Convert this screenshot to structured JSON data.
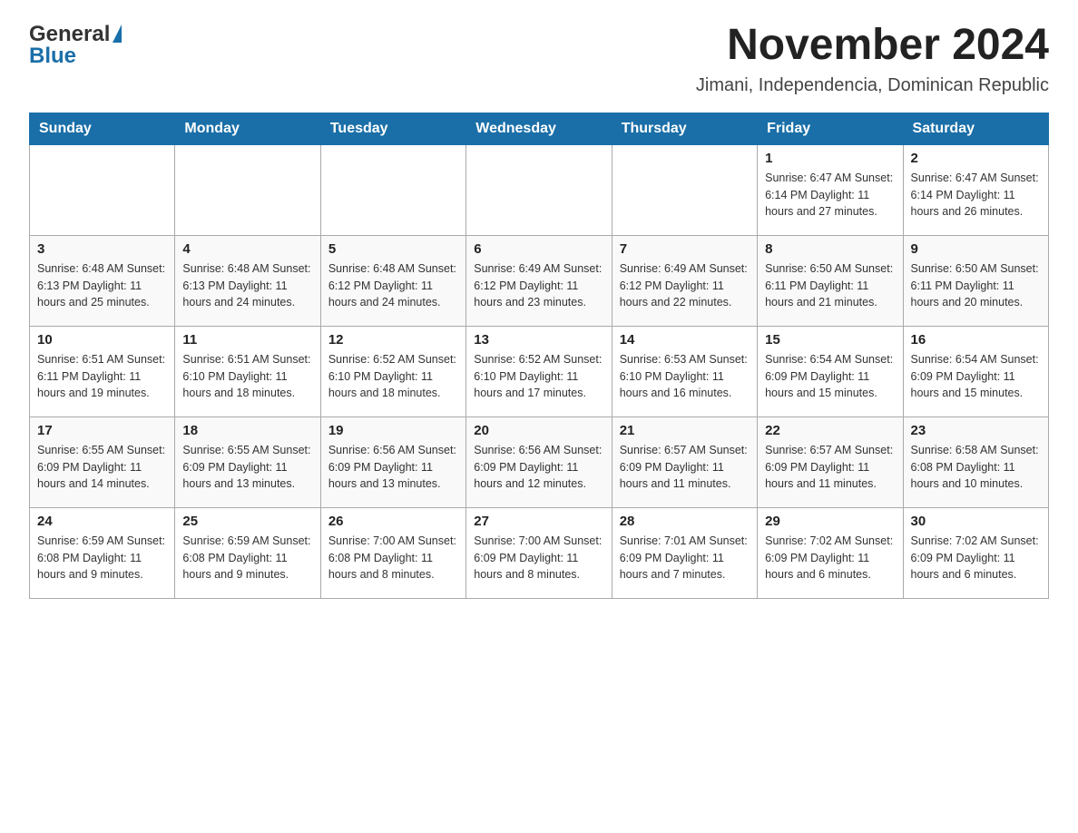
{
  "logo": {
    "general": "General",
    "blue": "Blue"
  },
  "title": "November 2024",
  "location": "Jimani, Independencia, Dominican Republic",
  "days_of_week": [
    "Sunday",
    "Monday",
    "Tuesday",
    "Wednesday",
    "Thursday",
    "Friday",
    "Saturday"
  ],
  "weeks": [
    [
      {
        "day": "",
        "info": ""
      },
      {
        "day": "",
        "info": ""
      },
      {
        "day": "",
        "info": ""
      },
      {
        "day": "",
        "info": ""
      },
      {
        "day": "",
        "info": ""
      },
      {
        "day": "1",
        "info": "Sunrise: 6:47 AM\nSunset: 6:14 PM\nDaylight: 11 hours\nand 27 minutes."
      },
      {
        "day": "2",
        "info": "Sunrise: 6:47 AM\nSunset: 6:14 PM\nDaylight: 11 hours\nand 26 minutes."
      }
    ],
    [
      {
        "day": "3",
        "info": "Sunrise: 6:48 AM\nSunset: 6:13 PM\nDaylight: 11 hours\nand 25 minutes."
      },
      {
        "day": "4",
        "info": "Sunrise: 6:48 AM\nSunset: 6:13 PM\nDaylight: 11 hours\nand 24 minutes."
      },
      {
        "day": "5",
        "info": "Sunrise: 6:48 AM\nSunset: 6:12 PM\nDaylight: 11 hours\nand 24 minutes."
      },
      {
        "day": "6",
        "info": "Sunrise: 6:49 AM\nSunset: 6:12 PM\nDaylight: 11 hours\nand 23 minutes."
      },
      {
        "day": "7",
        "info": "Sunrise: 6:49 AM\nSunset: 6:12 PM\nDaylight: 11 hours\nand 22 minutes."
      },
      {
        "day": "8",
        "info": "Sunrise: 6:50 AM\nSunset: 6:11 PM\nDaylight: 11 hours\nand 21 minutes."
      },
      {
        "day": "9",
        "info": "Sunrise: 6:50 AM\nSunset: 6:11 PM\nDaylight: 11 hours\nand 20 minutes."
      }
    ],
    [
      {
        "day": "10",
        "info": "Sunrise: 6:51 AM\nSunset: 6:11 PM\nDaylight: 11 hours\nand 19 minutes."
      },
      {
        "day": "11",
        "info": "Sunrise: 6:51 AM\nSunset: 6:10 PM\nDaylight: 11 hours\nand 18 minutes."
      },
      {
        "day": "12",
        "info": "Sunrise: 6:52 AM\nSunset: 6:10 PM\nDaylight: 11 hours\nand 18 minutes."
      },
      {
        "day": "13",
        "info": "Sunrise: 6:52 AM\nSunset: 6:10 PM\nDaylight: 11 hours\nand 17 minutes."
      },
      {
        "day": "14",
        "info": "Sunrise: 6:53 AM\nSunset: 6:10 PM\nDaylight: 11 hours\nand 16 minutes."
      },
      {
        "day": "15",
        "info": "Sunrise: 6:54 AM\nSunset: 6:09 PM\nDaylight: 11 hours\nand 15 minutes."
      },
      {
        "day": "16",
        "info": "Sunrise: 6:54 AM\nSunset: 6:09 PM\nDaylight: 11 hours\nand 15 minutes."
      }
    ],
    [
      {
        "day": "17",
        "info": "Sunrise: 6:55 AM\nSunset: 6:09 PM\nDaylight: 11 hours\nand 14 minutes."
      },
      {
        "day": "18",
        "info": "Sunrise: 6:55 AM\nSunset: 6:09 PM\nDaylight: 11 hours\nand 13 minutes."
      },
      {
        "day": "19",
        "info": "Sunrise: 6:56 AM\nSunset: 6:09 PM\nDaylight: 11 hours\nand 13 minutes."
      },
      {
        "day": "20",
        "info": "Sunrise: 6:56 AM\nSunset: 6:09 PM\nDaylight: 11 hours\nand 12 minutes."
      },
      {
        "day": "21",
        "info": "Sunrise: 6:57 AM\nSunset: 6:09 PM\nDaylight: 11 hours\nand 11 minutes."
      },
      {
        "day": "22",
        "info": "Sunrise: 6:57 AM\nSunset: 6:09 PM\nDaylight: 11 hours\nand 11 minutes."
      },
      {
        "day": "23",
        "info": "Sunrise: 6:58 AM\nSunset: 6:08 PM\nDaylight: 11 hours\nand 10 minutes."
      }
    ],
    [
      {
        "day": "24",
        "info": "Sunrise: 6:59 AM\nSunset: 6:08 PM\nDaylight: 11 hours\nand 9 minutes."
      },
      {
        "day": "25",
        "info": "Sunrise: 6:59 AM\nSunset: 6:08 PM\nDaylight: 11 hours\nand 9 minutes."
      },
      {
        "day": "26",
        "info": "Sunrise: 7:00 AM\nSunset: 6:08 PM\nDaylight: 11 hours\nand 8 minutes."
      },
      {
        "day": "27",
        "info": "Sunrise: 7:00 AM\nSunset: 6:09 PM\nDaylight: 11 hours\nand 8 minutes."
      },
      {
        "day": "28",
        "info": "Sunrise: 7:01 AM\nSunset: 6:09 PM\nDaylight: 11 hours\nand 7 minutes."
      },
      {
        "day": "29",
        "info": "Sunrise: 7:02 AM\nSunset: 6:09 PM\nDaylight: 11 hours\nand 6 minutes."
      },
      {
        "day": "30",
        "info": "Sunrise: 7:02 AM\nSunset: 6:09 PM\nDaylight: 11 hours\nand 6 minutes."
      }
    ]
  ]
}
